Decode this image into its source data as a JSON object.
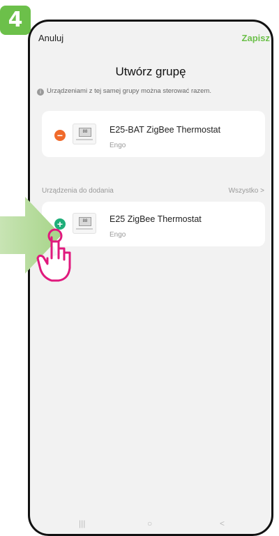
{
  "step_badge": "4",
  "topbar": {
    "cancel": "Anuluj",
    "save": "Zapisz"
  },
  "title": "Utwórz grupę",
  "hint": "Urządzeniami z tej samej grupy można sterować razem.",
  "group_devices": [
    {
      "name": "E25-BAT ZigBee Thermostat",
      "brand": "Engo",
      "lcd": "88"
    }
  ],
  "section": {
    "label": "Urządzenia do dodania",
    "all": "Wszystko >"
  },
  "available_devices": [
    {
      "name": "E25 ZigBee Thermostat",
      "brand": "Engo",
      "lcd": "88"
    }
  ],
  "navbar": {
    "recent": "|||",
    "home": "○",
    "back": "<"
  },
  "colors": {
    "accent": "#6cc04a",
    "remove": "#f06a2b",
    "add": "#1fae79",
    "hand": "#e0197d"
  },
  "icons": [
    "info-icon",
    "remove-icon",
    "add-icon",
    "thermostat-thumbnail",
    "pointing-hand-icon",
    "arrow-icon"
  ]
}
